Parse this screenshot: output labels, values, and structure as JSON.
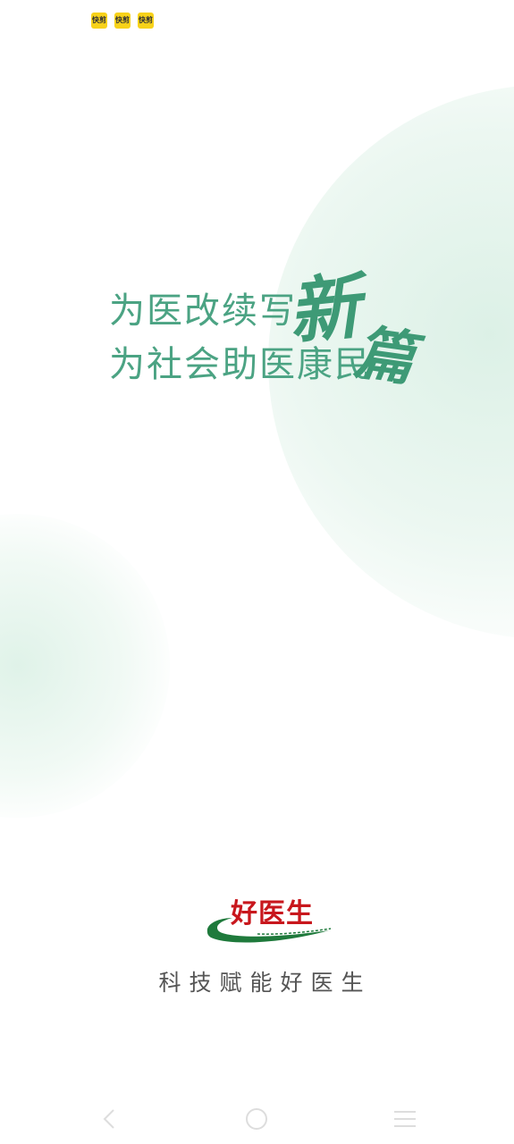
{
  "status_bar": {
    "icons": [
      {
        "name": "app-notification-icon",
        "text": "快剪"
      },
      {
        "name": "app-notification-icon",
        "text": "快剪"
      },
      {
        "name": "app-notification-icon",
        "text": "快剪"
      }
    ]
  },
  "splash": {
    "slogan_line1": "为医改续写",
    "slogan_line2": "为社会助医康民",
    "calligraphy_1": "新",
    "calligraphy_2": "篇",
    "logo_text": "好医生",
    "tagline": "科技赋能好医生"
  },
  "nav_bar": {
    "back_icon": "back-icon",
    "home_icon": "home-icon",
    "menu_icon": "menu-icon"
  },
  "colors": {
    "slogan_green": "#4ba383",
    "logo_red": "#c8171d",
    "logo_green": "#1f7a3c",
    "tagline_gray": "#555555",
    "nav_gray": "#dddddd"
  }
}
